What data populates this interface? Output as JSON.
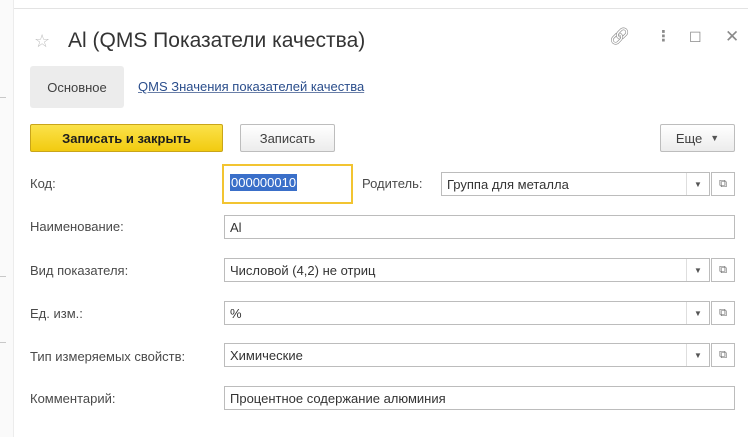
{
  "window": {
    "title": "Al (QMS Показатели качества)",
    "favorite_icon": "star-outline-icon",
    "header_icons": [
      "link-icon",
      "more-vertical-icon",
      "maximize-icon",
      "close-icon"
    ]
  },
  "tabs": {
    "main_label": "Основное",
    "values_link": "QMS Значения показателей качества"
  },
  "toolbar": {
    "save_close_label": "Записать и закрыть",
    "save_label": "Записать",
    "more_label": "Еще"
  },
  "form": {
    "code_label": "Код:",
    "code_value": "000000010",
    "parent_label": "Родитель:",
    "parent_value": "Группа для металла",
    "name_label": "Наименование:",
    "name_value": "Al",
    "indicator_type_label": "Вид показателя:",
    "indicator_type_value": "Числовой (4,2) не отриц",
    "unit_label": "Ед. изм.:",
    "unit_value": "%",
    "property_type_label": "Тип измеряемых свойств:",
    "property_type_value": "Химические",
    "comment_label": "Комментарий:",
    "comment_value": "Процентное содержание алюминия"
  },
  "colors": {
    "primary_button": "#f5d21f",
    "focus_border": "#f2c431",
    "selection": "#3a6fc9",
    "link": "#2b4e8c"
  }
}
